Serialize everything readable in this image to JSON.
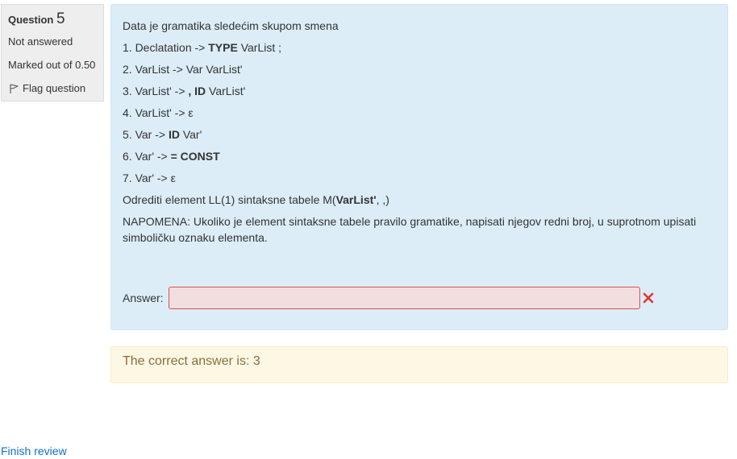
{
  "question_info": {
    "label": "Question",
    "number": "5",
    "state": "Not answered",
    "grade": "Marked out of 0.50",
    "flag_label": "Flag question"
  },
  "question": {
    "intro": "Data je gramatika sledećim skupom smena",
    "rules": [
      {
        "prefix": "1. Declatation -> ",
        "bold": "TYPE",
        "suffix": " VarList ;"
      },
      {
        "prefix": "2. VarList -> Var VarList'",
        "bold": "",
        "suffix": ""
      },
      {
        "prefix": "3.  VarList' -> ",
        "bold": ", ID",
        "suffix": " VarList'"
      },
      {
        "prefix": "4. VarList' -> ε",
        "bold": "",
        "suffix": ""
      },
      {
        "prefix": "5. Var -> ",
        "bold": "ID",
        "suffix": " Var'"
      },
      {
        "prefix": "6. Var' -> ",
        "bold": "= CONST",
        "suffix": ""
      },
      {
        "prefix": "7.  Var' -> ε",
        "bold": "",
        "suffix": ""
      }
    ],
    "task_prefix": "Odrediti element LL(1) sintaksne tabele M(",
    "task_bold": "VarList'",
    "task_suffix": ", ,)",
    "note": "NAPOMENA: Ukoliko je element sintaksne tabele pravilo gramatike, napisati njegov redni broj, u suprotnom upisati simboličku oznaku elementa.",
    "answer_label": "Answer:",
    "answer_value": ""
  },
  "feedback": {
    "right_answer": "The correct answer is: 3"
  },
  "nav": {
    "finish_review": "Finish review"
  },
  "colors": {
    "info_bg": "#eeeeee",
    "formulation_bg": "#dcedf7",
    "input_bg": "#f2dede",
    "input_border": "#d9534f",
    "wrong_icon": "#e3342f",
    "feedback_bg": "#fcf8e3",
    "feedback_text": "#8a6d3b",
    "link": "#0f6fc5"
  },
  "icons": {
    "flag": "flag-icon",
    "incorrect": "incorrect-cross-icon"
  }
}
